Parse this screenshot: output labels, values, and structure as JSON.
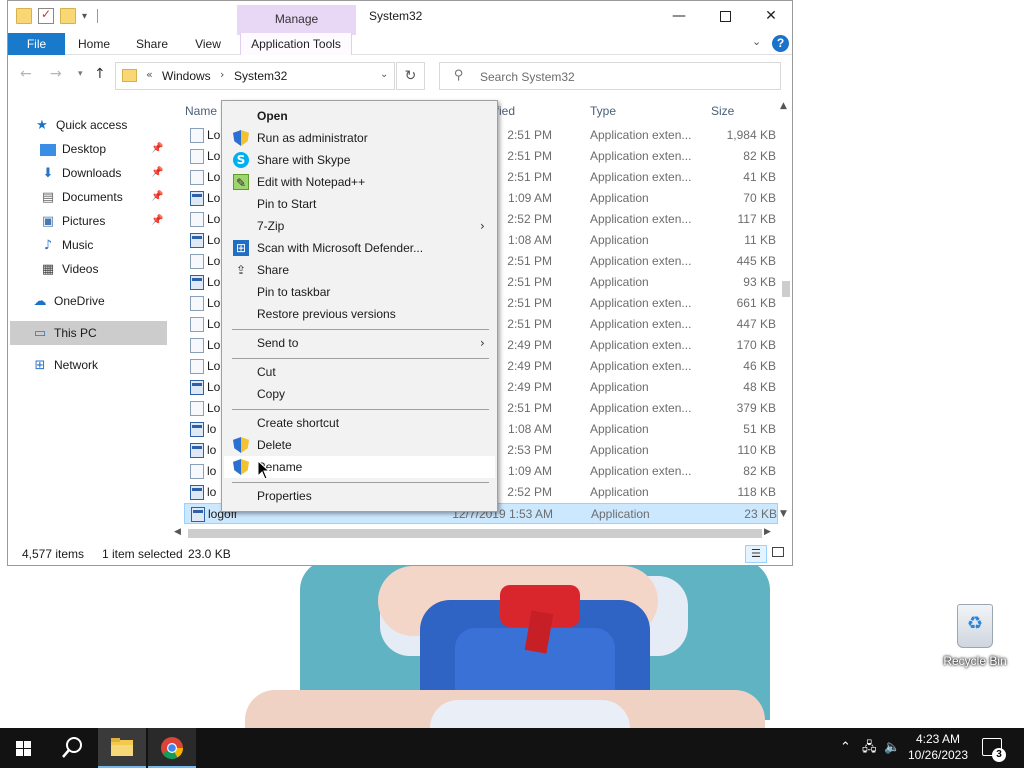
{
  "window": {
    "title": "System32",
    "context_tab": "Manage",
    "ribbon_tabs": [
      "File",
      "Home",
      "Share",
      "View",
      "Application Tools"
    ]
  },
  "address": {
    "overflow": "«",
    "crumbs": [
      "Windows",
      "System32"
    ],
    "separator": "›",
    "search_placeholder": "Search System32"
  },
  "nav_pane": {
    "quick_access": "Quick access",
    "desktop": "Desktop",
    "downloads": "Downloads",
    "documents": "Documents",
    "pictures": "Pictures",
    "music": "Music",
    "videos": "Videos",
    "onedrive": "OneDrive",
    "this_pc": "This PC",
    "network": "Network"
  },
  "columns": {
    "name": "Name",
    "date": "Date modified",
    "date_visible": "ified",
    "type": "Type",
    "size": "Size"
  },
  "files": [
    {
      "name": "Lo",
      "date": "2:51 PM",
      "type": "Application exten...",
      "size": "1,984 KB",
      "kind": "dll"
    },
    {
      "name": "Lo",
      "date": "2:51 PM",
      "type": "Application exten...",
      "size": "82 KB",
      "kind": "dll"
    },
    {
      "name": "Lo",
      "date": "2:51 PM",
      "type": "Application exten...",
      "size": "41 KB",
      "kind": "dll"
    },
    {
      "name": "Lo",
      "date": "1:09 AM",
      "type": "Application",
      "size": "70 KB",
      "kind": "app"
    },
    {
      "name": "Lo",
      "date": "2:52 PM",
      "type": "Application exten...",
      "size": "117 KB",
      "kind": "dll"
    },
    {
      "name": "Lo",
      "date": "1:08 AM",
      "type": "Application",
      "size": "11 KB",
      "kind": "app"
    },
    {
      "name": "Lo",
      "date": "2:51 PM",
      "type": "Application exten...",
      "size": "445 KB",
      "kind": "dll"
    },
    {
      "name": "Lo",
      "date": "2:51 PM",
      "type": "Application",
      "size": "93 KB",
      "kind": "app"
    },
    {
      "name": "Lo",
      "date": "2:51 PM",
      "type": "Application exten...",
      "size": "661 KB",
      "kind": "dll"
    },
    {
      "name": "Lo",
      "date": "2:51 PM",
      "type": "Application exten...",
      "size": "447 KB",
      "kind": "dll"
    },
    {
      "name": "Lo",
      "date": "2:49 PM",
      "type": "Application exten...",
      "size": "170 KB",
      "kind": "dll"
    },
    {
      "name": "Lo",
      "date": "2:49 PM",
      "type": "Application exten...",
      "size": "46 KB",
      "kind": "dll"
    },
    {
      "name": "Lo",
      "date": "2:49 PM",
      "type": "Application",
      "size": "48 KB",
      "kind": "app"
    },
    {
      "name": "Lo",
      "date": "2:51 PM",
      "type": "Application exten...",
      "size": "379 KB",
      "kind": "dll"
    },
    {
      "name": "lo",
      "date": "1:08 AM",
      "type": "Application",
      "size": "51 KB",
      "kind": "app"
    },
    {
      "name": "lo",
      "date": "2:53 PM",
      "type": "Application",
      "size": "110 KB",
      "kind": "app"
    },
    {
      "name": "lo",
      "date": "1:09 AM",
      "type": "Application exten...",
      "size": "82 KB",
      "kind": "dll"
    },
    {
      "name": "lo",
      "date": "2:52 PM",
      "type": "Application",
      "size": "118 KB",
      "kind": "app"
    },
    {
      "name": "logoff",
      "date": "12/7/2019 1:53 AM",
      "type": "Application",
      "size": "23 KB",
      "kind": "app",
      "selected": true
    }
  ],
  "status": {
    "count": "4,577 items",
    "selected": "1 item selected",
    "size": "23.0 KB"
  },
  "context_menu": {
    "open": "Open",
    "run_admin": "Run as administrator",
    "skype": "Share with Skype",
    "notepadpp": "Edit with Notepad++",
    "pin_start": "Pin to Start",
    "zip": "7-Zip",
    "defender": "Scan with Microsoft Defender...",
    "share": "Share",
    "pin_taskbar": "Pin to taskbar",
    "restore": "Restore previous versions",
    "send_to": "Send to",
    "cut": "Cut",
    "copy": "Copy",
    "create_shortcut": "Create shortcut",
    "delete": "Delete",
    "rename": "Rename",
    "properties": "Properties"
  },
  "desktop": {
    "recycle_bin": "Recycle Bin"
  },
  "taskbar": {
    "time": "4:23 AM",
    "date": "10/26/2023",
    "notifications": "3"
  },
  "icons": {
    "back": "←",
    "forward": "→",
    "up": "↑",
    "refresh": "↻",
    "search": "⚲",
    "minimize": "—",
    "close": "✕",
    "submenu": "›",
    "chevron": "⌄"
  }
}
